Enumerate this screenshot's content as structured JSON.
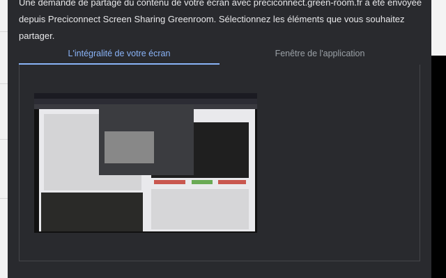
{
  "dialog": {
    "message": "Une demande de partage du contenu de votre écran avec preciconnect.green-room.fr a été envoyée depuis Preciconnect Screen Sharing Greenroom. Sélectionnez les éléments que vous souhaitez partager.",
    "tabs": [
      {
        "label": "L'intégralité de votre écran",
        "active": true
      },
      {
        "label": "Fenêtre de l'application",
        "active": false
      }
    ],
    "accent_color": "#8ab4f8"
  }
}
